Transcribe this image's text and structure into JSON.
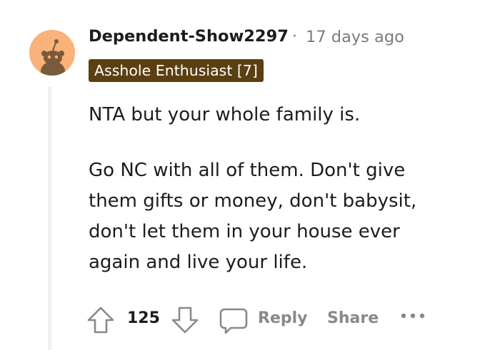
{
  "comment": {
    "author": "Dependent-Show2297",
    "separator": "·",
    "timestamp": "17 days ago",
    "flair": "Asshole Enthusiast [7]",
    "body": [
      "NTA but your whole family is.",
      "Go NC with all of them. Don't give\nthem gifts or money, don't babysit,\ndon't let them in your house ever\nagain and live your life."
    ],
    "vote_count": "125",
    "actions": {
      "reply_label": "Reply",
      "share_label": "Share"
    }
  },
  "icons": {
    "avatar": "snoo-avatar-icon",
    "upvote": "upvote-arrow-icon",
    "downvote": "downvote-arrow-icon",
    "reply": "speech-bubble-icon",
    "more": "more-dots-icon"
  },
  "colors": {
    "avatar_bg": "#f9b27a",
    "flair_bg": "#5a3f10",
    "flair_text": "#ffffff",
    "muted": "#7c7c7c",
    "action_text": "#878a8c",
    "thread_line": "#edeff1"
  }
}
